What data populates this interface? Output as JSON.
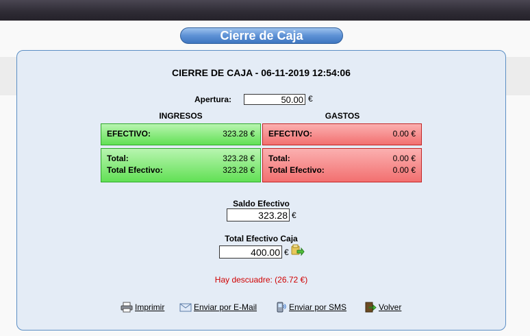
{
  "title": "Cierre de Caja",
  "heading": "CIERRE DE CAJA - 06-11-2019 12:54:06",
  "apertura": {
    "label": "Apertura:",
    "value": "50.00",
    "currency": "€"
  },
  "ingresos": {
    "title": "INGRESOS",
    "efectivo_label": "EFECTIVO:",
    "efectivo_value": "323.28 €",
    "total_label": "Total:",
    "total_value": "323.28 €",
    "total_efectivo_label": "Total Efectivo:",
    "total_efectivo_value": "323.28 €"
  },
  "gastos": {
    "title": "GASTOS",
    "efectivo_label": "EFECTIVO:",
    "efectivo_value": "0.00 €",
    "total_label": "Total:",
    "total_value": "0.00 €",
    "total_efectivo_label": "Total Efectivo:",
    "total_efectivo_value": "0.00 €"
  },
  "saldo": {
    "label": "Saldo Efectivo",
    "value": "323.28",
    "currency": "€"
  },
  "total_caja": {
    "label": "Total Efectivo Caja",
    "value": "400.00",
    "currency": "€"
  },
  "warning": "Hay descuadre: (26.72 €)",
  "actions": {
    "imprimir": "Imprimir",
    "email": "Enviar por E-Mail",
    "sms": "Enviar por SMS",
    "volver": "Volver"
  },
  "colors": {
    "ingresos_bg": "#7fe874",
    "gastos_bg": "#f58a8a",
    "warning": "#d00000",
    "accent": "#4a82c8"
  }
}
